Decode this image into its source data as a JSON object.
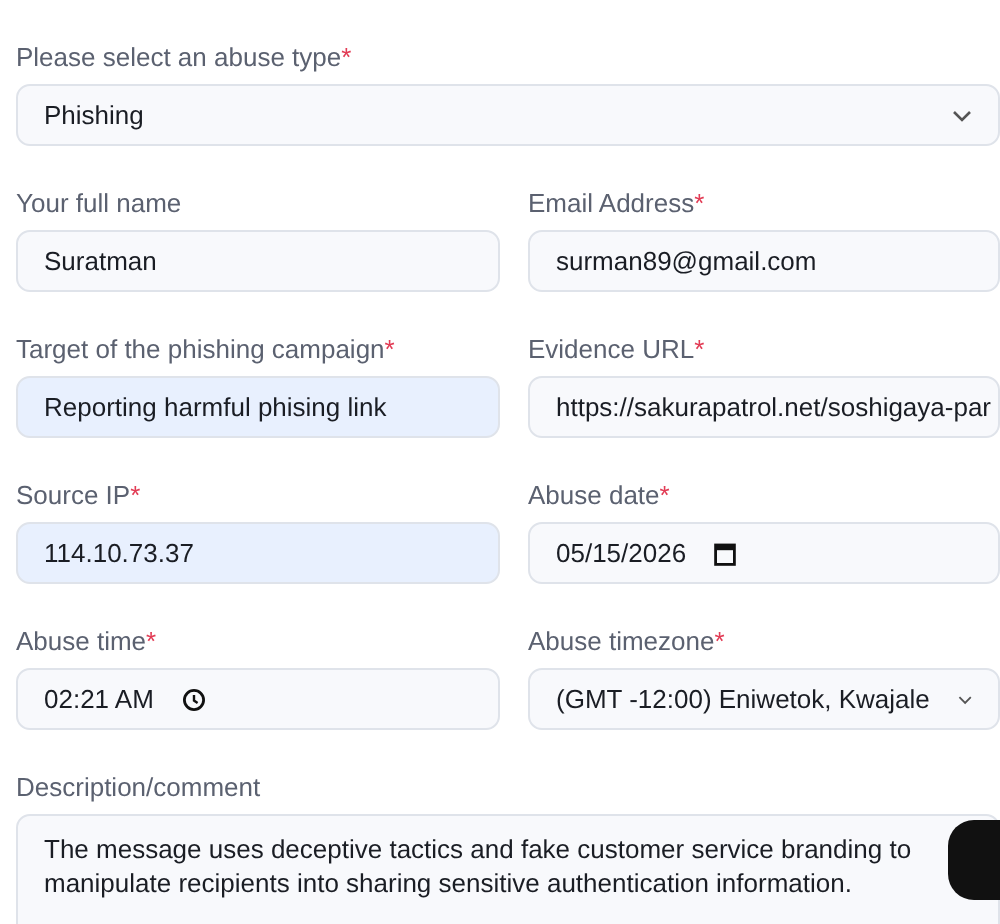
{
  "form": {
    "fields": [
      {
        "kind": "select",
        "label": "Please select an abuse type",
        "required_mark": "*",
        "value": "Phishing",
        "autofilled": false,
        "wide": true
      },
      {
        "kind": "text",
        "label": "Your full name",
        "value": "Suratman",
        "autofilled": false,
        "wide": false
      },
      {
        "kind": "text",
        "label": "Email Address",
        "required_mark": "*",
        "value": "surman89@gmail.com",
        "autofilled": false,
        "wide": false
      },
      {
        "kind": "text",
        "label": "Target of the phishing campaign",
        "required_mark": "*",
        "value": "Reporting harmful phising link",
        "autofilled": true,
        "wide": false
      },
      {
        "kind": "text",
        "label": "Evidence URL",
        "required_mark": "*",
        "value": "https://sakurapatrol.net/soshigaya-par",
        "autofilled": false,
        "wide": false
      },
      {
        "kind": "text",
        "label": "Source IP",
        "required_mark": "*",
        "value": "114.10.73.37",
        "autofilled": true,
        "wide": false
      },
      {
        "kind": "date",
        "label": "Abuse date",
        "required_mark": "*",
        "value": "05/15/2026",
        "autofilled": false,
        "wide": false
      },
      {
        "kind": "time",
        "label": "Abuse time",
        "required_mark": "*",
        "value": "02:21 AM",
        "autofilled": false,
        "wide": false
      },
      {
        "kind": "select",
        "label": "Abuse timezone",
        "required_mark": "*",
        "value": "(GMT -12:00) Eniwetok, Kwajale",
        "autofilled": false,
        "wide": false
      },
      {
        "kind": "textarea",
        "label": "Description/comment",
        "value": "The message uses deceptive tactics and fake customer service branding to manipulate recipients into sharing sensitive authentication information.",
        "autofilled": false,
        "wide": true
      }
    ]
  }
}
